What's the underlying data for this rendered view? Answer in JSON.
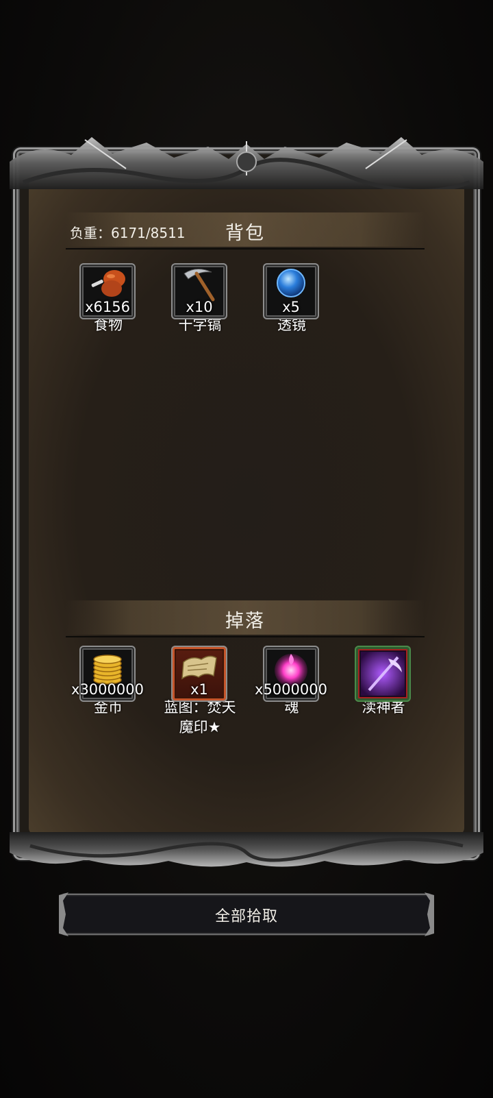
{
  "backpack": {
    "title": "背包",
    "weight_label": "负重：6171/8511",
    "items": [
      {
        "name": "食物",
        "qty": "x6156",
        "icon": "food-drumstick-icon"
      },
      {
        "name": "十字镐",
        "qty": "x10",
        "icon": "pickaxe-icon"
      },
      {
        "name": "透镜",
        "qty": "x5",
        "icon": "blue-lens-orb-icon"
      }
    ]
  },
  "drops": {
    "title": "掉落",
    "items": [
      {
        "name": "金币",
        "qty": "x3000000",
        "icon": "gold-coins-icon"
      },
      {
        "name": "蓝图：焚天魔印★",
        "name_line1": "蓝图：焚天",
        "name_line2": "魔印★",
        "qty": "x1",
        "icon": "blueprint-scroll-icon"
      },
      {
        "name": "魂",
        "qty": "x5000000",
        "icon": "soul-pink-orb-icon"
      },
      {
        "name": "渎神者",
        "qty": "",
        "icon": "purple-scythe-weapon-icon"
      }
    ]
  },
  "actions": {
    "pickup_all": "全部拾取"
  },
  "colors": {
    "parchment": "#261f18",
    "frame_metal": "#8d8d8d",
    "text": "#f2efe8",
    "rare_border": "#c5552a",
    "epic_border": "#4a8a4a"
  }
}
